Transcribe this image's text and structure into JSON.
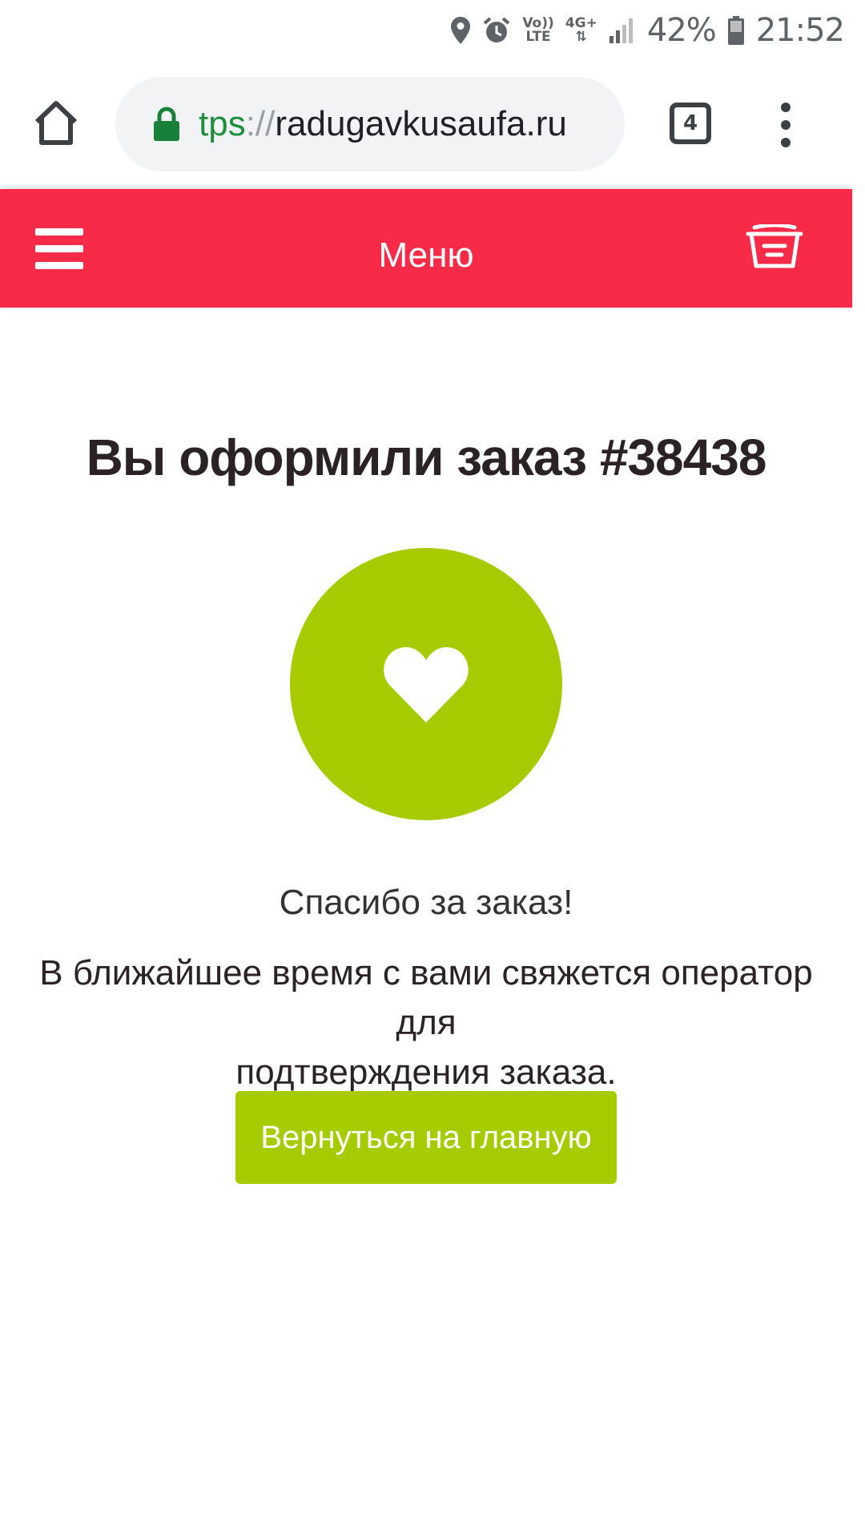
{
  "status_bar": {
    "volte_label_top": "Vo))",
    "volte_label_bottom": "LTE",
    "network_label": "4G+",
    "battery": "42%",
    "time": "21:52"
  },
  "browser": {
    "url_scheme": "tps",
    "url_separator": "://",
    "url_host": "radugavkusaufa.ru",
    "tab_count": "4"
  },
  "header": {
    "title": "Меню",
    "accent_color": "#f72b47"
  },
  "main": {
    "order_title": "Вы оформили заказ #38438",
    "thanks": "Спасибо за заказ!",
    "info_line1": "В ближайшее время с вами свяжется оператор для",
    "info_line2": "подтверждения заказа.",
    "home_button_label": "Вернуться на главную",
    "accent_color": "#a6cc00"
  }
}
